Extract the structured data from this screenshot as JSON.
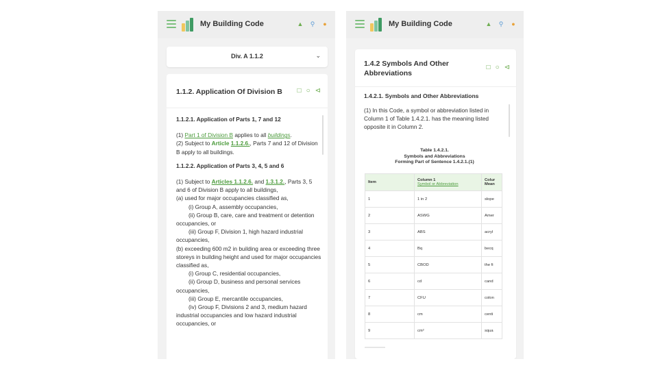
{
  "app": {
    "title": "My Building Code"
  },
  "icons": {
    "menu": "hamburger-icon",
    "home": "home-icon",
    "search": "search-icon",
    "user": "user-icon",
    "bookmark": "bookmark-icon",
    "comment": "comment-icon",
    "share": "share-icon"
  },
  "colors": {
    "accent_green": "#4a9a3a",
    "topbar_bg": "#eeeeee",
    "table_header_bg": "#e9f5e5"
  },
  "left": {
    "division_select": {
      "value": "Div. A 1.1.2"
    },
    "section_title": "1.1.2. Application Of Division B",
    "content": {
      "sub1": "1.1.2.1. Application of Parts 1, 7 and 12",
      "p1_prefix": "(1) ",
      "p1_link1": "Part 1 of Division B",
      "p1_mid": " applies to all ",
      "p1_link2": "buildings",
      "p1_end": ".",
      "p2_prefix": "(2) Subject to ",
      "p2_link1": "Article",
      "p2_space": " ",
      "p2_link2": "1.1.2.6.",
      "p2_end": ", Parts 7 and 12 of Division B apply to all buildings.",
      "sub2": "1.1.2.2. Application of Parts 3, 4, 5 and 6",
      "p3_prefix": "(1) Subject to ",
      "p3_link1": "Articles 1.1.2.6.",
      "p3_mid": " and ",
      "p3_link2": "1.3.1.2.",
      "p3_end": ", Parts 3, 5 and 6 of Division B apply to all buildings,",
      "la": "(a) used for major occupancies classified as,",
      "la_i": "(i) Group A, assembly occupancies,",
      "la_ii": "(ii) Group B, care, care and treatment or detention occupancies, or",
      "la_iii": "(iii) Group F, Division 1, high hazard industrial occupancies,",
      "lb": "(b) exceeding 600 m2 in building area or exceeding three storeys in building height and used for major occupancies classified as,",
      "lb_i": "(i) Group C, residential occupancies,",
      "lb_ii": "(ii) Group D, business and personal services occupancies,",
      "lb_iii": "(iii) Group E, mercantile occupancies,",
      "lb_iv": "(iv) Group F, Divisions 2 and 3, medium hazard industrial occupancies and low hazard industrial occupancies, or"
    }
  },
  "right": {
    "section_title": "1.4.2 Symbols And Other Abbreviations",
    "sub1": "1.4.2.1. Symbols and Other Abbreviations",
    "para": "(1) In this Code, a symbol or abbreviation listed in Column 1 of Table 1.4.2.1. has the meaning listed opposite it in Column 2.",
    "caption": {
      "line1": "Table 1.4.2.1.",
      "line2": "Symbols and Abbreviations",
      "line3": "Forming Part of Sentence 1.4.2.1.(1)"
    },
    "table": {
      "headers": {
        "item": "Item",
        "col1_line1": "Column 1",
        "col1_line2": "Symbol or Abbreviation",
        "col2_line1": "Colur",
        "col2_line2": "Mean"
      },
      "rows": [
        {
          "item": "1",
          "symbol": "1 in 2",
          "meaning": "slope"
        },
        {
          "item": "2",
          "symbol": "ASWG",
          "meaning": "Amer"
        },
        {
          "item": "3",
          "symbol": "ABS",
          "meaning": "acryl"
        },
        {
          "item": "4",
          "symbol": "Bq",
          "meaning": "becq"
        },
        {
          "item": "5",
          "symbol": "CBOD",
          "meaning": "the fi"
        },
        {
          "item": "6",
          "symbol": "cd",
          "meaning": "cand"
        },
        {
          "item": "7",
          "symbol": "CFU",
          "meaning": "colon"
        },
        {
          "item": "8",
          "symbol": "cm",
          "meaning": "centi"
        },
        {
          "item": "9",
          "symbol": "cm²",
          "meaning": "squa"
        }
      ]
    }
  }
}
